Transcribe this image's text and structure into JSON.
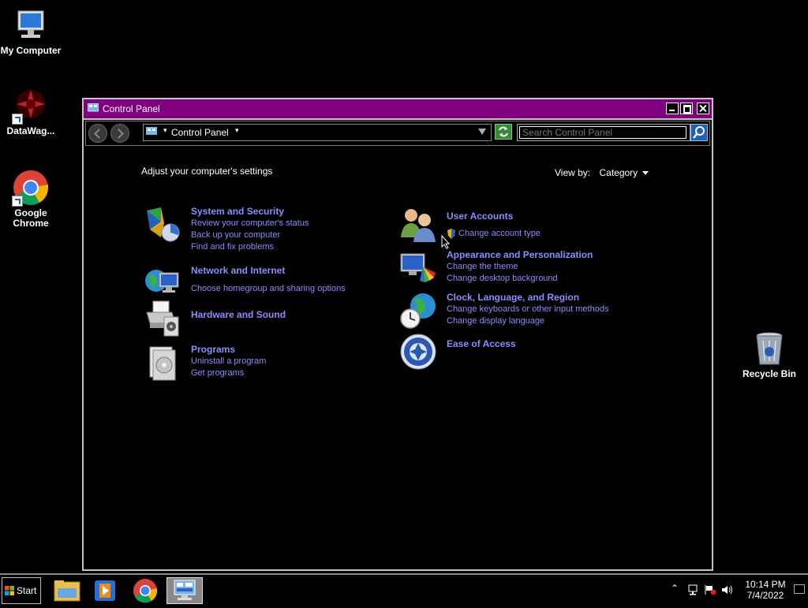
{
  "desktop": {
    "icons": [
      {
        "label": "My Computer"
      },
      {
        "label": "DataWag..."
      },
      {
        "label": "Google Chrome"
      },
      {
        "label": "Recycle Bin"
      }
    ]
  },
  "window": {
    "title": "Control Panel",
    "address": {
      "path": "Control Panel"
    },
    "search": {
      "placeholder": "Search Control Panel"
    },
    "heading": "Adjust your computer's settings",
    "view_by": {
      "label": "View by:",
      "value": "Category"
    },
    "categories": [
      {
        "title": "System and Security",
        "links": [
          "Review your computer's status",
          "Back up your computer",
          "Find and fix problems"
        ],
        "icon": "shield-icon"
      },
      {
        "title": "Network and Internet",
        "links": [
          "Choose homegroup and sharing options"
        ],
        "icon": "network-icon"
      },
      {
        "title": "Hardware and Sound",
        "links": [],
        "icon": "printer-icon"
      },
      {
        "title": "Programs",
        "links": [
          "Uninstall a program",
          "Get programs"
        ],
        "icon": "programs-icon"
      },
      {
        "title": "User Accounts",
        "links": [
          "Change account type"
        ],
        "icon": "users-icon"
      },
      {
        "title": "Appearance and Personalization",
        "links": [
          "Change the theme",
          "Change desktop background"
        ],
        "icon": "appearance-icon"
      },
      {
        "title": "Clock, Language, and Region",
        "links": [
          "Change keyboards or other input methods",
          "Change display language"
        ],
        "icon": "clock-globe-icon"
      },
      {
        "title": "Ease of Access",
        "links": [],
        "icon": "ease-of-access-icon"
      }
    ]
  },
  "taskbar": {
    "start_label": "Start",
    "clock": {
      "time": "10:14 PM",
      "date": "7/4/2022"
    }
  },
  "colors": {
    "titlebar": "#800080",
    "link": "#8c8cff"
  }
}
